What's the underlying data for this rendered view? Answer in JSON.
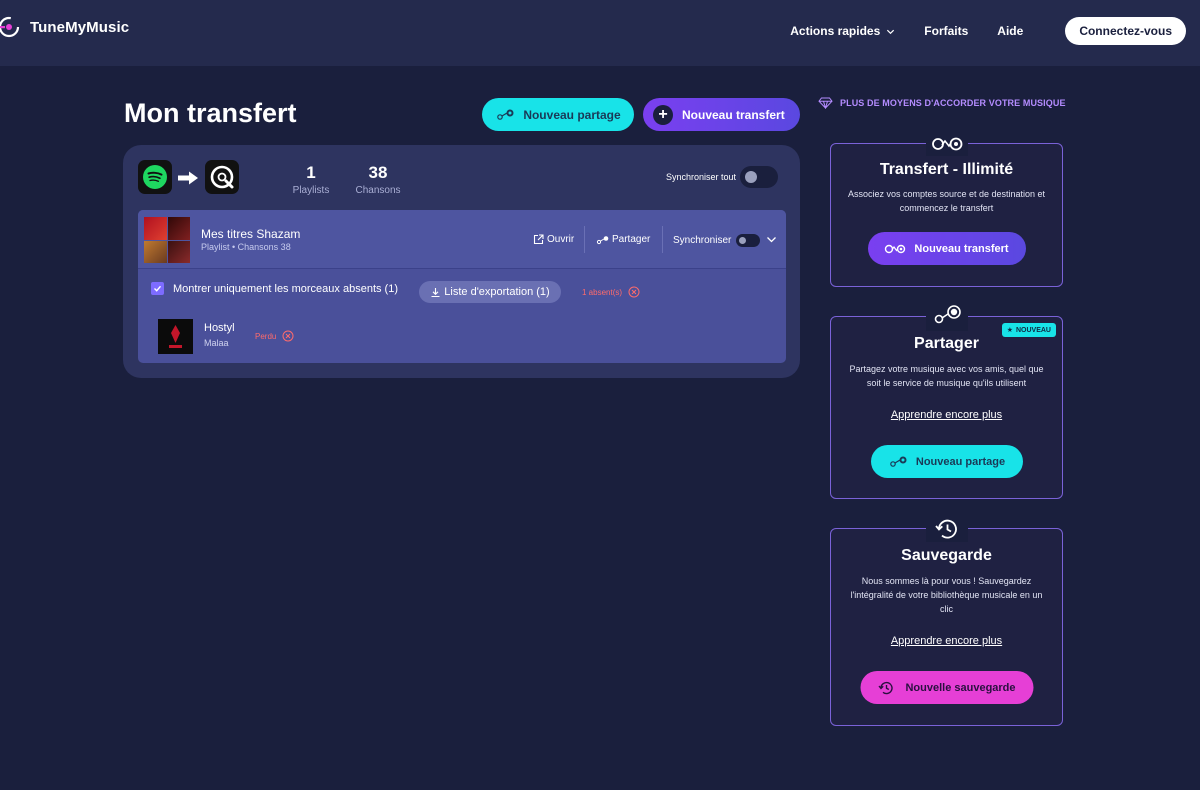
{
  "nav": {
    "brand": "TuneMyMusic",
    "quick_actions": "Actions rapides",
    "plans": "Forfaits",
    "help": "Aide",
    "login": "Connectez-vous"
  },
  "main": {
    "title": "Mon transfert",
    "share_button": "Nouveau partage",
    "transfer_button": "Nouveau transfert",
    "transfer": {
      "source_service": "spotify-icon",
      "destination_service": "qobuz-icon",
      "playlists_count": "1",
      "playlists_label": "Playlists",
      "songs_count": "38",
      "songs_label": "Chansons",
      "sync_all_label": "Synchroniser tout",
      "playlist": {
        "name": "Mes titres Shazam",
        "meta": "Playlist • Chansons 38",
        "open_label": "Ouvrir",
        "share_label": "Partager",
        "sync_label": "Synchroniser",
        "filter_label": "Montrer uniquement les morceaux absents (1)",
        "export_label": "Liste d'exportation (1)",
        "missing_label": "1 absent(s)",
        "tracks": [
          {
            "title": "Hostyl",
            "artist": "Malaa",
            "status": "Perdu"
          }
        ]
      }
    }
  },
  "sidebar": {
    "more_ways": "PLUS DE MOYENS D'ACCORDER VOTRE MUSIQUE",
    "cards": [
      {
        "title": "Transfert - Illimité",
        "desc": "Associez vos comptes source et de destination et commencez le transfert",
        "button": "Nouveau transfert"
      },
      {
        "title": "Partager",
        "badge": "NOUVEAU",
        "desc": "Partagez votre musique avec vos amis, quel que soit le service de musique qu'ils utilisent",
        "link": "Apprendre encore plus",
        "button": "Nouveau partage"
      },
      {
        "title": "Sauvegarde",
        "desc": "Nous sommes là pour vous ! Sauvegardez l'intégralité de votre bibliothèque musicale en un clic",
        "link": "Apprendre encore plus",
        "button": "Nouvelle sauvegarde"
      }
    ]
  },
  "colors": {
    "background": "#1a1f3d",
    "cyan": "#18e3e8",
    "purple": "#7a3ff0",
    "pink": "#e63fd6",
    "missing_red": "#ff6b6b"
  }
}
